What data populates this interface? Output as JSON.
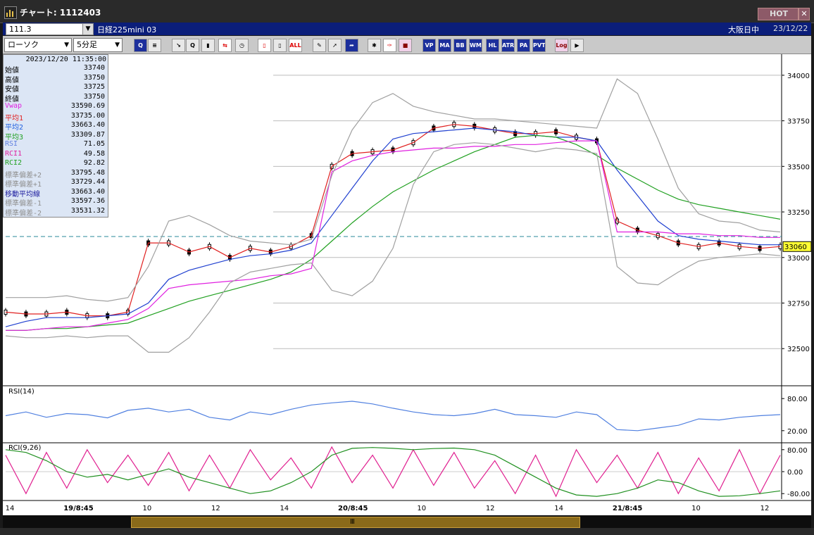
{
  "window": {
    "title": "チャート: 1112403",
    "hot_label": "HOT",
    "close_label": "✕"
  },
  "infobar": {
    "code": "111.3",
    "instrument": "日経225mini 03",
    "market": "大阪日中",
    "date": "23/12/22"
  },
  "toolbar": {
    "chart_type": "ローソク",
    "interval": "5分足",
    "buttons": [
      {
        "name": "zoom-icon",
        "label": "Q",
        "style": "blue"
      },
      {
        "name": "list-icon",
        "label": "≡",
        "style": "plain"
      },
      {
        "name": "trend-icon",
        "label": "↘",
        "style": "plain"
      },
      {
        "name": "search-chart-icon",
        "label": "Q",
        "style": "plain"
      },
      {
        "name": "bar-icon",
        "label": "▮",
        "style": "plain"
      },
      {
        "name": "split-icon",
        "label": "⇆",
        "style": "red"
      },
      {
        "name": "clock-icon",
        "label": "◷",
        "style": "plain"
      },
      {
        "name": "candle-icon",
        "label": "▯",
        "style": "red"
      },
      {
        "name": "candle2-icon",
        "label": "▯",
        "style": "plain"
      },
      {
        "name": "all-icon",
        "label": "ALL",
        "style": "red"
      },
      {
        "name": "pencil-icon",
        "label": "✎",
        "style": "plain"
      },
      {
        "name": "cursor-icon",
        "label": "➚",
        "style": "plain"
      },
      {
        "name": "arrow-icon",
        "label": "➦",
        "style": "blue"
      },
      {
        "name": "settings-icon",
        "label": "✱",
        "style": "plain"
      },
      {
        "name": "wrench-icon",
        "label": "✑",
        "style": "red"
      },
      {
        "name": "palette-icon",
        "label": "■",
        "style": "pink"
      },
      {
        "name": "vwap-icon",
        "label": "VP",
        "style": "blue"
      },
      {
        "name": "ma-icon",
        "label": "MA",
        "style": "blue"
      },
      {
        "name": "bb-icon",
        "label": "BB",
        "style": "blue"
      },
      {
        "name": "wma-icon",
        "label": "WMA",
        "style": "blue"
      },
      {
        "name": "hl-icon",
        "label": "HL",
        "style": "blue"
      },
      {
        "name": "atr-icon",
        "label": "ATR",
        "style": "blue"
      },
      {
        "name": "para-icon",
        "label": "PA",
        "style": "blue"
      },
      {
        "name": "pvt-icon",
        "label": "PVT",
        "style": "blue"
      },
      {
        "name": "log-icon",
        "label": "Log",
        "style": "pink"
      },
      {
        "name": "export-icon",
        "label": "▶",
        "style": "plain"
      }
    ]
  },
  "info_panel": {
    "timestamp": "2023/12/20  11:35:00",
    "rows": [
      {
        "label": "始値",
        "value": "33740",
        "color": "#000000"
      },
      {
        "label": "高値",
        "value": "33750",
        "color": "#000000"
      },
      {
        "label": "安値",
        "value": "33725",
        "color": "#000000"
      },
      {
        "label": "終値",
        "value": "33750",
        "color": "#000000"
      },
      {
        "label": "Vwap",
        "value": "33590.69",
        "color": "#e020e0"
      },
      {
        "label": "平均1",
        "value": "33735.00",
        "color": "#e02020"
      },
      {
        "label": "平均2",
        "value": "33663.40",
        "color": "#2060e0"
      },
      {
        "label": "平均3",
        "value": "33309.87",
        "color": "#20a020"
      },
      {
        "label": "RSI",
        "value": "71.05",
        "color": "#6080e0"
      },
      {
        "label": "RCI1",
        "value": "49.58",
        "color": "#e020a0"
      },
      {
        "label": "RCI2",
        "value": "92.82",
        "color": "#20a020"
      },
      {
        "label": "標準偏差+2",
        "value": "33795.48",
        "color": "#909090"
      },
      {
        "label": "標準偏差+1",
        "value": "33729.44",
        "color": "#909090"
      },
      {
        "label": "移動平均線",
        "value": "33663.40",
        "color": "#2020a0"
      },
      {
        "label": "標準偏差-1",
        "value": "33597.36",
        "color": "#909090"
      },
      {
        "label": "標準偏差-2",
        "value": "33531.32",
        "color": "#909090"
      }
    ]
  },
  "chart_data": [
    {
      "type": "line",
      "panel": "price",
      "ylim": [
        32300,
        34100
      ],
      "yticks": [
        "34000",
        "33750",
        "33500",
        "33250",
        "33000",
        "32750",
        "32500"
      ],
      "current_price_label": "33060",
      "current_price": 33060,
      "reference_line": 33115,
      "x_labels": [
        "14",
        "19/8:45",
        "10",
        "12",
        "14",
        "20/8:45",
        "10",
        "12",
        "14",
        "21/8:45",
        "10",
        "12"
      ],
      "series": [
        {
          "name": "平均1",
          "color": "#e02020",
          "values": [
            32700,
            32690,
            32690,
            32700,
            32680,
            32680,
            32700,
            33080,
            33080,
            33030,
            33060,
            33000,
            33050,
            33030,
            33060,
            33120,
            33500,
            33570,
            33580,
            33590,
            33630,
            33710,
            33730,
            33720,
            33700,
            33680,
            33680,
            33690,
            33660,
            33640,
            33200,
            33150,
            33120,
            33080,
            33060,
            33080,
            33060,
            33050,
            33060
          ]
        },
        {
          "name": "平均2",
          "color": "#2040d0",
          "values": [
            32620,
            32650,
            32670,
            32670,
            32670,
            32680,
            32690,
            32750,
            32880,
            32930,
            32960,
            32990,
            33010,
            33020,
            33040,
            33080,
            33230,
            33380,
            33530,
            33650,
            33680,
            33690,
            33700,
            33710,
            33700,
            33690,
            33670,
            33660,
            33660,
            33640,
            33480,
            33340,
            33200,
            33120,
            33100,
            33090,
            33080,
            33070,
            33070
          ]
        },
        {
          "name": "平均3",
          "color": "#20a020",
          "values": [
            32600,
            32600,
            32610,
            32610,
            32620,
            32630,
            32640,
            32680,
            32720,
            32760,
            32790,
            32820,
            32850,
            32880,
            32920,
            32990,
            33090,
            33190,
            33280,
            33360,
            33420,
            33480,
            33530,
            33580,
            33620,
            33660,
            33670,
            33660,
            33620,
            33560,
            33490,
            33430,
            33370,
            33320,
            33290,
            33270,
            33250,
            33230,
            33210
          ]
        },
        {
          "name": "Vwap",
          "color": "#e020e0",
          "values": [
            32600,
            32600,
            32610,
            32620,
            32620,
            32640,
            32660,
            32720,
            32830,
            32850,
            32860,
            32870,
            32880,
            32900,
            32910,
            32940,
            33470,
            33530,
            33560,
            33580,
            33590,
            33600,
            33600,
            33610,
            33610,
            33620,
            33620,
            33630,
            33640,
            33640,
            33140,
            33140,
            33140,
            33130,
            33130,
            33120,
            33120,
            33110,
            33110
          ]
        },
        {
          "name": "標準偏差+2",
          "color": "#a0a0a0",
          "values": [
            32780,
            32780,
            32780,
            32790,
            32770,
            32760,
            32780,
            32950,
            33200,
            33230,
            33180,
            33120,
            33090,
            33080,
            33070,
            33100,
            33450,
            33700,
            33850,
            33900,
            33830,
            33800,
            33780,
            33760,
            33760,
            33750,
            33740,
            33730,
            33720,
            33710,
            33980,
            33900,
            33650,
            33380,
            33240,
            33200,
            33190,
            33150,
            33140
          ]
        },
        {
          "name": "標準偏差-2",
          "color": "#a0a0a0",
          "values": [
            32570,
            32560,
            32560,
            32570,
            32560,
            32570,
            32570,
            32480,
            32480,
            32560,
            32700,
            32860,
            32920,
            32940,
            32960,
            32970,
            32820,
            32790,
            32870,
            33050,
            33400,
            33580,
            33620,
            33630,
            33620,
            33600,
            33580,
            33600,
            33590,
            33570,
            32950,
            32860,
            32850,
            32920,
            32980,
            33000,
            33010,
            33020,
            33010
          ]
        }
      ]
    },
    {
      "type": "line",
      "panel": "RSI",
      "title": "RSI(14)",
      "ylim": [
        0,
        100
      ],
      "yticks": [
        "80.00",
        "20.00"
      ],
      "series": [
        {
          "name": "RSI",
          "color": "#5080e0",
          "values": [
            48,
            55,
            45,
            52,
            50,
            44,
            58,
            62,
            55,
            60,
            45,
            40,
            55,
            50,
            60,
            68,
            72,
            75,
            70,
            62,
            55,
            50,
            48,
            52,
            60,
            50,
            48,
            45,
            55,
            50,
            22,
            20,
            25,
            30,
            42,
            40,
            45,
            48,
            50
          ]
        }
      ]
    },
    {
      "type": "line",
      "panel": "RCI",
      "title": "RCI(9,26)",
      "ylim": [
        -100,
        100
      ],
      "yticks": [
        "80.00",
        "0.00",
        "-80.00"
      ],
      "series": [
        {
          "name": "RCI1",
          "color": "#e02090",
          "values": [
            60,
            -80,
            70,
            -60,
            80,
            -40,
            60,
            -50,
            70,
            -70,
            60,
            -60,
            80,
            -30,
            50,
            -60,
            90,
            -40,
            60,
            -60,
            80,
            -50,
            70,
            -60,
            40,
            -80,
            60,
            -90,
            80,
            -40,
            60,
            -60,
            70,
            -80,
            50,
            -70,
            80,
            -80,
            60
          ]
        },
        {
          "name": "RCI2",
          "color": "#209020",
          "values": [
            80,
            70,
            40,
            0,
            -20,
            -10,
            -30,
            -10,
            10,
            -20,
            -40,
            -60,
            -80,
            -70,
            -40,
            0,
            60,
            85,
            88,
            85,
            80,
            84,
            86,
            80,
            60,
            20,
            -20,
            -60,
            -85,
            -90,
            -80,
            -60,
            -30,
            -40,
            -70,
            -90,
            -88,
            -80,
            -70
          ]
        }
      ]
    }
  ]
}
